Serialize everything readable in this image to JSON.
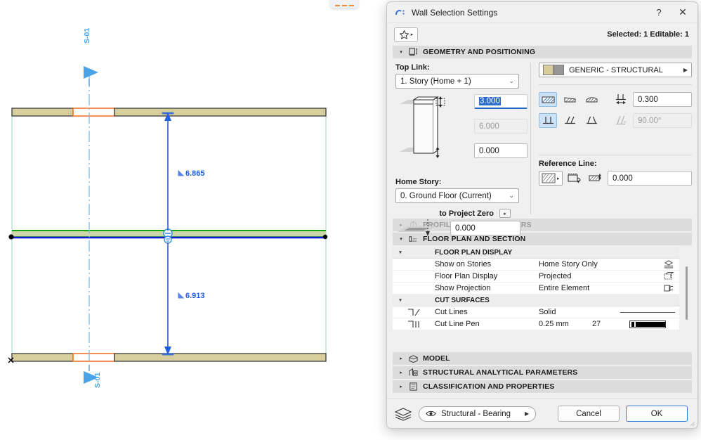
{
  "window": {
    "title": "Wall Selection Settings",
    "help_label": "?",
    "close_label": "✕",
    "app_icon": "archicad-wall-icon"
  },
  "subbar": {
    "favorites_icon": "star-icon",
    "favorites_arrow": "▸",
    "selection_info": "Selected: 1 Editable: 1"
  },
  "sections": [
    {
      "id": "geometry",
      "label": "GEOMETRY AND POSITIONING",
      "expanded": true,
      "icon": "geometry-positioning-icon",
      "triangle": "▾"
    },
    {
      "id": "profile_offset",
      "label": "PROFILE OFFSET MODIFIERS",
      "expanded": false,
      "dim": true,
      "icon": "profile-offset-icon",
      "triangle": "▸"
    },
    {
      "id": "floor_plan_section",
      "label": "FLOOR PLAN AND SECTION",
      "expanded": true,
      "icon": "floor-plan-section-icon",
      "triangle": "▾"
    },
    {
      "id": "model",
      "label": "MODEL",
      "expanded": false,
      "icon": "model-icon",
      "triangle": "▸"
    },
    {
      "id": "structural_analytical",
      "label": "STRUCTURAL ANALYTICAL PARAMETERS",
      "expanded": false,
      "icon": "structural-analytical-icon",
      "triangle": "▸"
    },
    {
      "id": "classification",
      "label": "CLASSIFICATION AND PROPERTIES",
      "expanded": false,
      "icon": "classification-icon",
      "triangle": "▸"
    }
  ],
  "geometry": {
    "top_link_label": "Top Link:",
    "top_link_value": "1. Story (Home + 1)",
    "top_link_chevron": "⌄",
    "height_value": "3.000",
    "height_readonly_value": "6.000",
    "base_offset_value": "0.000",
    "home_story_label": "Home Story:",
    "home_story_value": "0. Ground Floor (Current)",
    "home_story_chevron": "⌄",
    "project_zero_label": "to Project Zero",
    "project_zero_arrow": "▸",
    "project_zero_value": "0.000",
    "material_name": "GENERIC - STRUCTURAL",
    "material_chevron": "▶",
    "material_swatch_1": "#d8cc9a",
    "material_swatch_2": "#969696",
    "structure_icons": [
      "composite-structure-icon",
      "tapered-structure-icon",
      "complex-profile-icon"
    ],
    "structure_selected_index": 0,
    "thickness_icon": "wall-thickness-icon",
    "thickness_value": "0.300",
    "slant_icons": [
      "vertical-wall-icon",
      "slanted-wall-icon",
      "double-slanted-wall-icon"
    ],
    "slant_selected_index": 0,
    "angle_icon": "slant-angle-icon",
    "angle_value": "90.00°",
    "reference_line_label": "Reference Line:",
    "reference_line_fill_icon": "reference-line-fill-icon",
    "reference_line_fill_arrow": "▸",
    "reference_line_flip_icon": "flip-reference-line-icon",
    "reference_line_offset_icon": "reference-line-offset-icon",
    "reference_line_offset_value": "0.000"
  },
  "floor_plan": {
    "groups": [
      {
        "title": "FLOOR PLAN DISPLAY",
        "triangle": "▾",
        "rows": [
          {
            "name": "Show on Stories",
            "value": "Home Story Only",
            "icon": "show-on-stories-icon"
          },
          {
            "name": "Floor Plan Display",
            "value": "Projected",
            "icon": "floor-plan-display-icon"
          },
          {
            "name": "Show Projection",
            "value": "Entire Element",
            "icon": "show-projection-icon"
          }
        ]
      },
      {
        "title": "CUT SURFACES",
        "triangle": "▾",
        "rows": [
          {
            "name": "Cut Lines",
            "value": "Solid",
            "icon": "cut-lines-icon",
            "preview": "line-sample"
          },
          {
            "name": "Cut Line Pen",
            "value": "0.25 mm",
            "number": "27",
            "icon": "cut-line-pen-icon",
            "preview": "pen-sample"
          }
        ]
      }
    ]
  },
  "footer": {
    "layer_icon": "layers-icon",
    "layer_eye_icon": "eye-icon",
    "layer_value": "Structural - Bearing",
    "layer_arrow": "▶",
    "cancel_label": "Cancel",
    "ok_label": "OK"
  },
  "cad": {
    "section_marker_top_label": "S-01",
    "section_marker_bottom_label": "S-01",
    "dimension_upper": "6.865",
    "dimension_lower": "6.913",
    "colors": {
      "wall_fill": "#d8cf9e",
      "wall_outline": "#3b3b3b",
      "opening_orange": "#f5742a",
      "selected_green": "#13a213",
      "selected_blue": "#1414e0",
      "marker_blue": "#4aa3e8",
      "dimension_blue": "#1f5fe0",
      "guide_teal": "#a8ddd0"
    }
  }
}
